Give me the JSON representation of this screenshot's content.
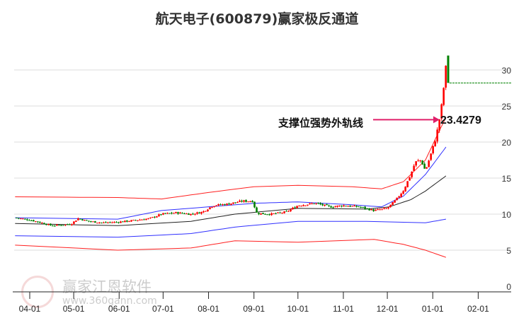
{
  "chart_data": {
    "type": "candlestick",
    "title": "航天电子(600879)赢家极反通道",
    "x_unit": "days since 04-01",
    "y_ticks": [
      0,
      5,
      10,
      15,
      20,
      25,
      30
    ],
    "ylim": [
      0,
      32
    ],
    "x_ticks": [
      {
        "label": "04-01",
        "d": 0
      },
      {
        "label": "05-01",
        "d": 30
      },
      {
        "label": "06-01",
        "d": 61
      },
      {
        "label": "07-01",
        "d": 91
      },
      {
        "label": "08-01",
        "d": 122
      },
      {
        "label": "09-01",
        "d": 153
      },
      {
        "label": "10-01",
        "d": 183
      },
      {
        "label": "11-01",
        "d": 214
      },
      {
        "label": "12-01",
        "d": 244
      },
      {
        "label": "01-01",
        "d": 275
      },
      {
        "label": "02-01",
        "d": 306
      }
    ],
    "price_path": [
      [
        -10,
        9.5
      ],
      [
        0,
        9.2
      ],
      [
        8,
        8.8
      ],
      [
        15,
        8.4
      ],
      [
        22,
        8.5
      ],
      [
        28,
        8.6
      ],
      [
        33,
        9.4
      ],
      [
        40,
        9.0
      ],
      [
        50,
        8.8
      ],
      [
        60,
        8.9
      ],
      [
        70,
        9.1
      ],
      [
        82,
        9.4
      ],
      [
        90,
        10.0
      ],
      [
        100,
        10.2
      ],
      [
        110,
        10.0
      ],
      [
        118,
        10.3
      ],
      [
        125,
        11.2
      ],
      [
        135,
        11.4
      ],
      [
        145,
        11.8
      ],
      [
        152,
        11.8
      ],
      [
        155,
        10.1
      ],
      [
        165,
        10.0
      ],
      [
        175,
        10.3
      ],
      [
        183,
        11.2
      ],
      [
        195,
        11.5
      ],
      [
        205,
        11.0
      ],
      [
        214,
        11.2
      ],
      [
        225,
        11.0
      ],
      [
        235,
        10.5
      ],
      [
        244,
        10.8
      ],
      [
        250,
        12.0
      ],
      [
        255,
        13.3
      ],
      [
        260,
        15.5
      ],
      [
        263,
        17.2
      ],
      [
        267,
        17.5
      ],
      [
        270,
        16.0
      ],
      [
        274,
        18.5
      ],
      [
        277,
        20.5
      ],
      [
        279,
        22.5
      ],
      [
        281,
        25.0
      ],
      [
        283,
        28.5
      ],
      [
        284,
        30.5
      ]
    ],
    "last_candle": {
      "open": 32.0,
      "close": 28.2
    },
    "bands": [
      {
        "name": "outer-upper",
        "color": "#ff2020",
        "points": [
          [
            -10,
            12.4
          ],
          [
            60,
            12.3
          ],
          [
            90,
            12.1
          ],
          [
            122,
            13.0
          ],
          [
            153,
            13.8
          ],
          [
            183,
            14.0
          ],
          [
            220,
            13.8
          ],
          [
            240,
            13.5
          ],
          [
            255,
            14.5
          ],
          [
            270,
            17.5
          ],
          [
            280,
            21.8
          ],
          [
            284,
            23.4
          ]
        ]
      },
      {
        "name": "inner-upper",
        "color": "#3030ff",
        "points": [
          [
            -10,
            9.5
          ],
          [
            60,
            9.3
          ],
          [
            90,
            10.5
          ],
          [
            153,
            11.5
          ],
          [
            183,
            11.7
          ],
          [
            220,
            11.3
          ],
          [
            240,
            11.0
          ],
          [
            255,
            12.5
          ],
          [
            270,
            15.5
          ],
          [
            284,
            19.3
          ]
        ]
      },
      {
        "name": "middle",
        "color": "#222222",
        "points": [
          [
            -10,
            8.7
          ],
          [
            60,
            8.4
          ],
          [
            110,
            9.0
          ],
          [
            140,
            10.0
          ],
          [
            183,
            10.8
          ],
          [
            230,
            10.7
          ],
          [
            245,
            11.0
          ],
          [
            260,
            12.0
          ],
          [
            270,
            13.2
          ],
          [
            284,
            15.3
          ]
        ]
      },
      {
        "name": "inner-lower",
        "color": "#3030ff",
        "points": [
          [
            -10,
            7.0
          ],
          [
            60,
            6.8
          ],
          [
            110,
            7.3
          ],
          [
            140,
            8.2
          ],
          [
            183,
            9.0
          ],
          [
            230,
            9.0
          ],
          [
            270,
            8.8
          ],
          [
            284,
            9.3
          ]
        ]
      },
      {
        "name": "outer-lower",
        "color": "#ff2020",
        "points": [
          [
            -10,
            5.7
          ],
          [
            60,
            5.0
          ],
          [
            110,
            5.3
          ],
          [
            140,
            6.3
          ],
          [
            183,
            6.1
          ],
          [
            235,
            6.5
          ],
          [
            255,
            5.8
          ],
          [
            270,
            5.0
          ],
          [
            284,
            4.0
          ]
        ]
      }
    ],
    "annotation": {
      "label": "支撑位强势外轨线",
      "value": "23.4279"
    },
    "colors": {
      "up": "#ff0000",
      "down": "#008000",
      "arrow": "#e0206a"
    }
  },
  "watermark": {
    "brand": "赢家江恩软件",
    "url": "www.360gann.com",
    "seal": "江赢恩家"
  }
}
